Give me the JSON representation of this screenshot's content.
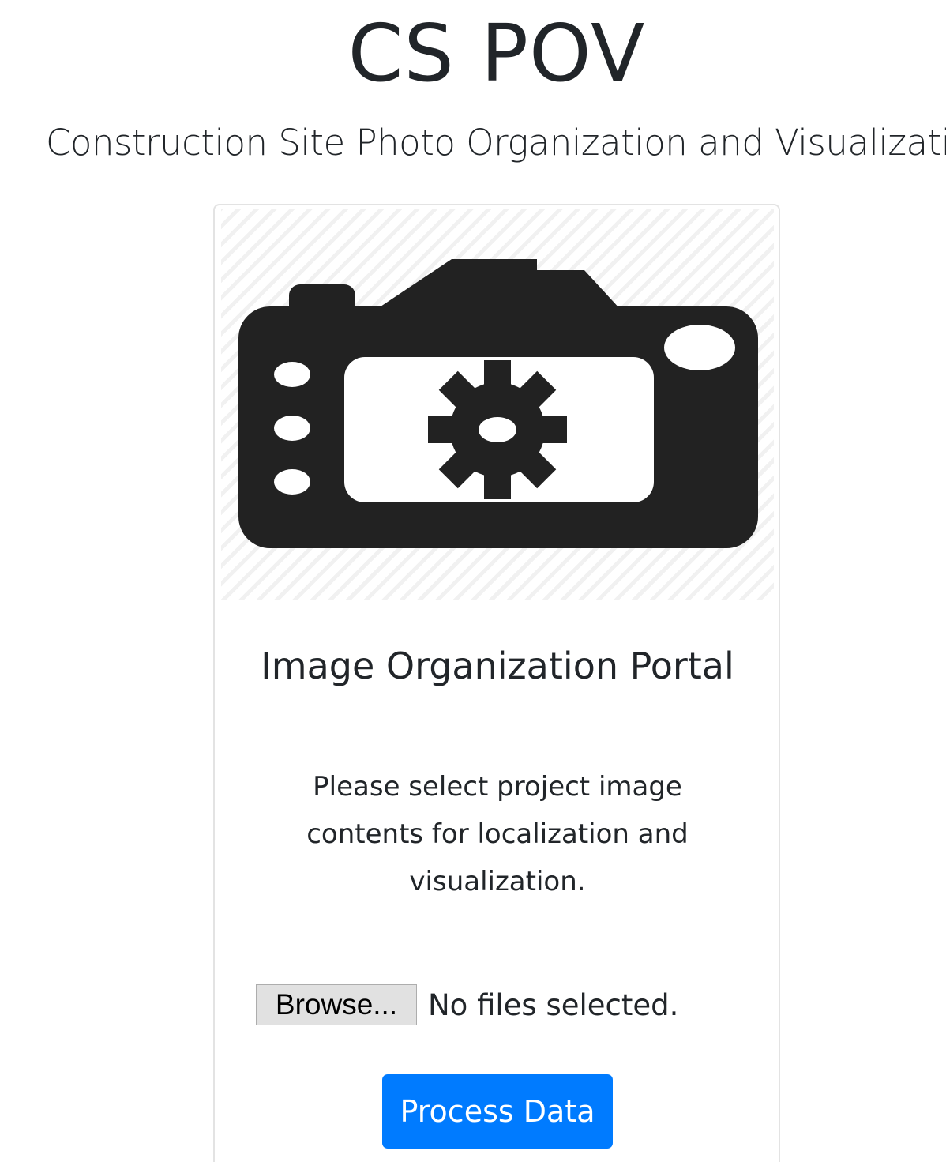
{
  "header": {
    "title": "CS POV",
    "subtitle": "Construction Site Photo Organization and Visualization"
  },
  "card": {
    "image_icon": "camera-gear-icon",
    "title": "Image Organization Portal",
    "text": "Please select project image contents for localization and visualization.",
    "file_input": {
      "browse_label": "Browse...",
      "status": "No files selected."
    },
    "process_button_label": "Process Data"
  },
  "colors": {
    "primary": "#007bff",
    "icon": "#222222",
    "stripe": "#f1f1f1"
  }
}
